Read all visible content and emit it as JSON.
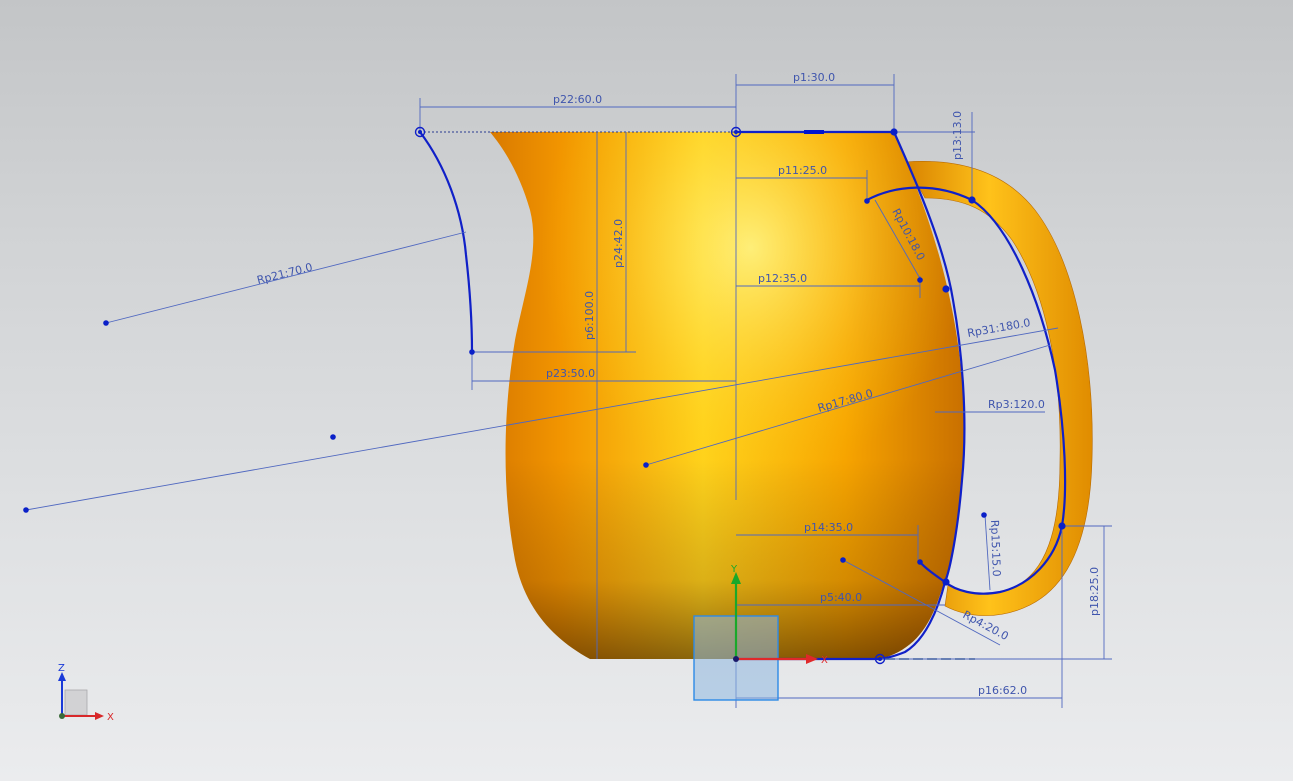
{
  "dimensions": {
    "p22": "p22:60.0",
    "p1": "p1:30.0",
    "p13": "p13:13.0",
    "p11": "p11:25.0",
    "p10": "Rp10:18.0",
    "p12": "p12:35.0",
    "p21": "Rp21:70.0",
    "p24": "p24:42.0",
    "p6": "p6:100.0",
    "p23": "p23:50.0",
    "p31": "Rp31:180.0",
    "p17": "Rp17:80.0",
    "p3": "Rp3:120.0",
    "p14": "p14:35.0",
    "p15": "Rp15:15.0",
    "p5": "p5:40.0",
    "p4": "Rp4:20.0",
    "p18": "p18:25.0",
    "p16": "p16:62.0"
  },
  "sketch_csys": {
    "x_label": "X",
    "y_label": "Y"
  },
  "triad": {
    "z_label": "Z",
    "x_label": "X"
  },
  "colors": {
    "body": "#f7a200",
    "sketch_curve": "#1020c8",
    "dimension": "#3f55ad",
    "background_top": "#c3c5c7",
    "background_bottom": "#ebecee"
  }
}
